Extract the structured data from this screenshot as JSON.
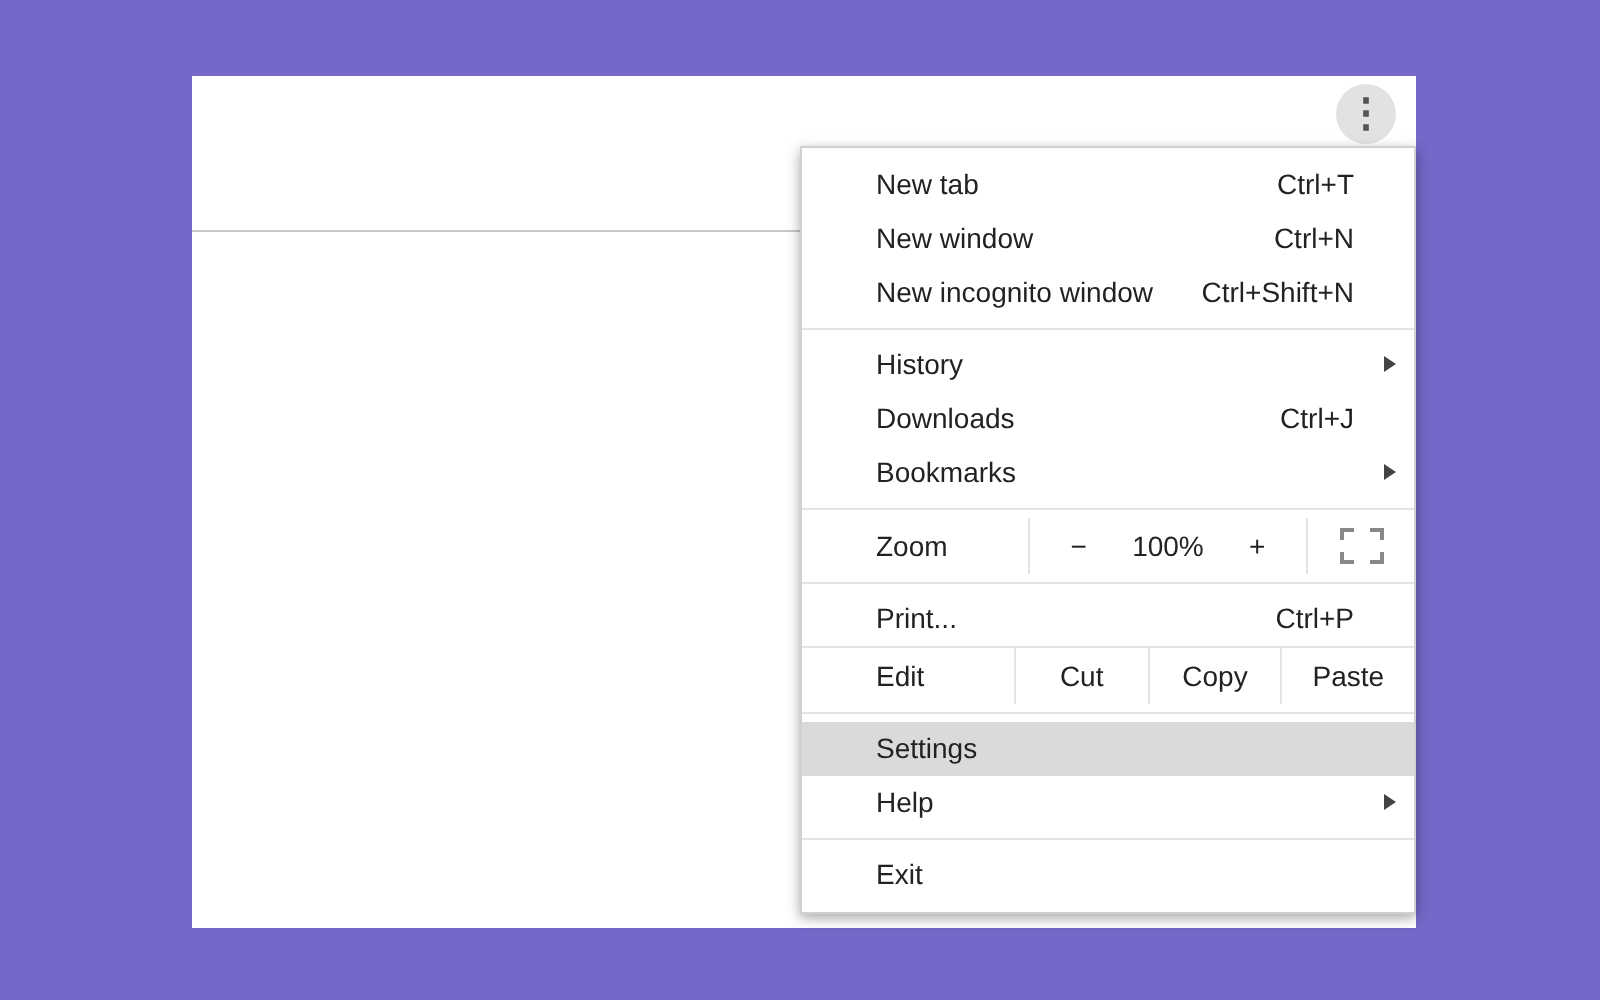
{
  "menu_button": {
    "label": "⋮"
  },
  "menu": {
    "sections": [
      {
        "items": [
          {
            "kind": "item",
            "label": "New tab",
            "shortcut": "Ctrl+T",
            "submenu": false,
            "selected": false
          },
          {
            "kind": "item",
            "label": "New window",
            "shortcut": "Ctrl+N",
            "submenu": false,
            "selected": false
          },
          {
            "kind": "item",
            "label": "New incognito window",
            "shortcut": "Ctrl+Shift+N",
            "submenu": false,
            "selected": false
          }
        ]
      },
      {
        "items": [
          {
            "kind": "item",
            "label": "History",
            "submenu": true,
            "selected": false
          },
          {
            "kind": "item",
            "label": "Downloads",
            "shortcut": "Ctrl+J",
            "submenu": false,
            "selected": false
          },
          {
            "kind": "item",
            "label": "Bookmarks",
            "submenu": true,
            "selected": false
          }
        ]
      },
      {
        "items": [
          {
            "kind": "zoom",
            "label": "Zoom",
            "minus": "−",
            "value": "100%",
            "plus": "+"
          }
        ]
      },
      {
        "items": [
          {
            "kind": "item",
            "label": "Print...",
            "shortcut": "Ctrl+P",
            "submenu": false,
            "selected": false
          },
          {
            "kind": "edit",
            "label": "Edit",
            "actions": [
              "Cut",
              "Copy",
              "Paste"
            ]
          }
        ]
      },
      {
        "items": [
          {
            "kind": "item",
            "label": "Settings",
            "submenu": false,
            "selected": true
          },
          {
            "kind": "item",
            "label": "Help",
            "submenu": true,
            "selected": false
          }
        ]
      },
      {
        "items": [
          {
            "kind": "item",
            "label": "Exit",
            "submenu": false,
            "selected": false
          }
        ]
      }
    ]
  }
}
